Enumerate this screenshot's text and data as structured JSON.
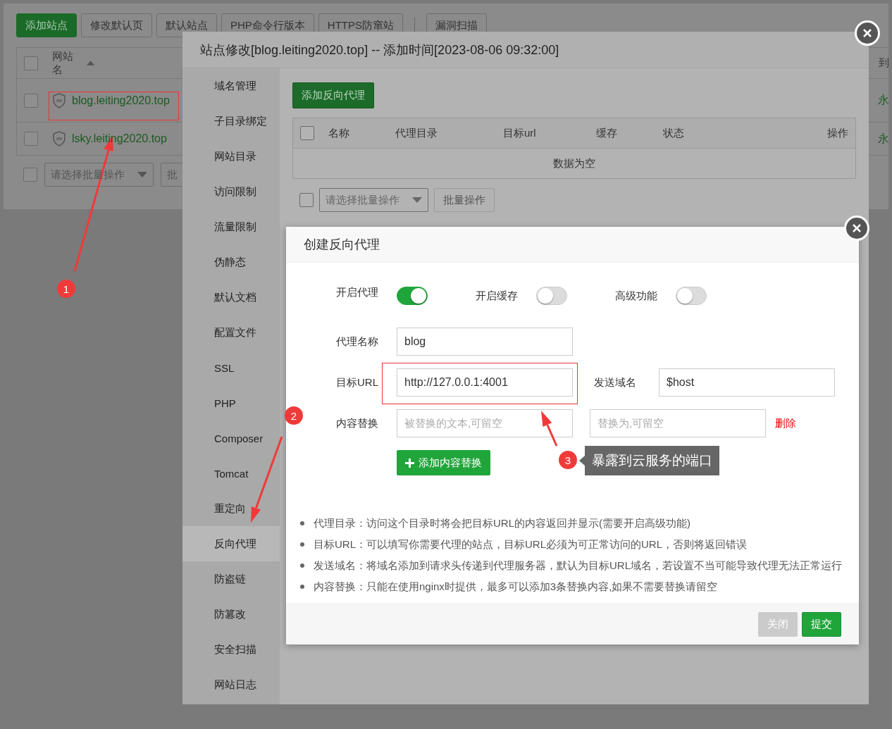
{
  "background": {
    "toolbar": [
      {
        "label": "添加站点",
        "primary": true
      },
      {
        "label": "修改默认页",
        "primary": false
      },
      {
        "label": "默认站点",
        "primary": false
      },
      {
        "label": "PHP命令行版本",
        "primary": false
      },
      {
        "label": "HTTPS防窜站",
        "primary": false
      },
      {
        "label": "漏洞扫描",
        "primary": false
      }
    ],
    "header_checked": false,
    "columns": [
      "网站名",
      "到"
    ],
    "rows": [
      {
        "checked": false,
        "name": "blog.leiting2020.top",
        "column_2": "永"
      },
      {
        "checked": false,
        "name": "lsky.leiting2020.top",
        "column_2": "永"
      }
    ],
    "batch_checked": false,
    "batch_select": "请选择批量操作",
    "batch_button": "批"
  },
  "dialog": {
    "title": "站点修改[blog.leiting2020.top] -- 添加时间[2023-08-06 09:32:00]",
    "sidebar": [
      {
        "label": "域名管理",
        "selected": false
      },
      {
        "label": "子目录绑定",
        "selected": false
      },
      {
        "label": "网站目录",
        "selected": false
      },
      {
        "label": "访问限制",
        "selected": false
      },
      {
        "label": "流量限制",
        "selected": false
      },
      {
        "label": "伪静态",
        "selected": false
      },
      {
        "label": "默认文档",
        "selected": false
      },
      {
        "label": "配置文件",
        "selected": false
      },
      {
        "label": "SSL",
        "selected": false
      },
      {
        "label": "PHP",
        "selected": false
      },
      {
        "label": "Composer",
        "selected": false
      },
      {
        "label": "Tomcat",
        "selected": false
      },
      {
        "label": "重定向",
        "selected": false
      },
      {
        "label": "反向代理",
        "selected": true
      },
      {
        "label": "防盗链",
        "selected": false
      },
      {
        "label": "防篡改",
        "selected": false
      },
      {
        "label": "安全扫描",
        "selected": false
      },
      {
        "label": "网站日志",
        "selected": false
      }
    ],
    "add_button": "添加反向代理",
    "header_checked": false,
    "batch_checked": false,
    "columns": [
      "名称",
      "代理目录",
      "目标url",
      "缓存",
      "状态",
      "操作"
    ],
    "empty": "数据为空",
    "batch_select": "请选择批量操作",
    "batch_button": "批量操作"
  },
  "modal": {
    "title": "创建反向代理",
    "toggles": [
      {
        "label": "开启代理",
        "on": true
      },
      {
        "label": "开启缓存",
        "on": false
      },
      {
        "label": "高级功能",
        "on": false
      }
    ],
    "name_label": "代理名称",
    "name_value": "blog",
    "url_label": "目标URL",
    "url_value": "http://127.0.0.1:4001",
    "host_label": "发送域名",
    "host_value": "$host",
    "replace_label": "内容替换",
    "replace_from_placeholder": "被替换的文本,可留空",
    "replace_to_placeholder": "替换为,可留空",
    "delete": "删除",
    "add_replace": "添加内容替换",
    "notes": [
      "代理目录：访问这个目录时将会把目标URL的内容返回并显示(需要开启高级功能)",
      "目标URL：可以填写你需要代理的站点，目标URL必须为可正常访问的URL，否则将返回错误",
      "发送域名：将域名添加到请求头传递到代理服务器，默认为目标URL域名，若设置不当可能导致代理无法正常运行",
      "内容替换：只能在使用nginx时提供，最多可以添加3条替换内容,如果不需要替换请留空"
    ],
    "buttons": [
      {
        "label": "关闭",
        "disabled": true
      },
      {
        "label": "提交",
        "disabled": false
      }
    ]
  },
  "annotations": [
    "1",
    "2",
    "3"
  ],
  "tooltip": "暴露到云服务的端口"
}
